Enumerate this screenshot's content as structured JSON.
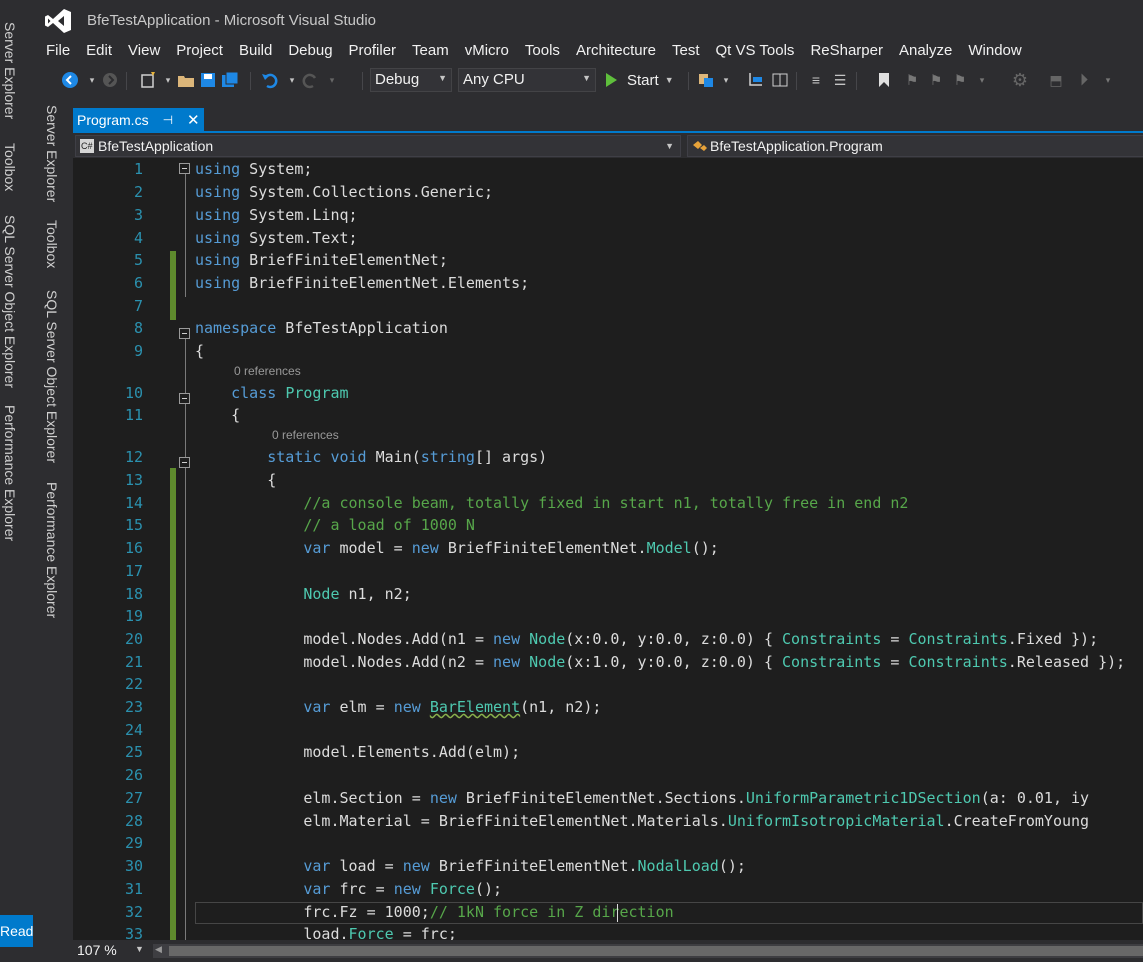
{
  "window": {
    "title": "BfeTestApplication - Microsoft Visual Studio"
  },
  "menu": [
    "File",
    "Edit",
    "View",
    "Project",
    "Build",
    "Debug",
    "Profiler",
    "Team",
    "vMicro",
    "Tools",
    "Architecture",
    "Test",
    "Qt VS Tools",
    "ReSharper",
    "Analyze",
    "Window"
  ],
  "toolbar": {
    "config": "Debug",
    "platform": "Any CPU",
    "start_label": "Start"
  },
  "side_tabs": [
    "Server Explorer",
    "Toolbox",
    "SQL Server Object Explorer",
    "Performance Explorer"
  ],
  "side_tabs_inner": [
    "Server Explorer",
    "Toolbox",
    "SQL Server Object Explorer",
    "Performance Explorer"
  ],
  "document_tab": {
    "name": "Program.cs"
  },
  "navbar": {
    "project": "BfeTestApplication",
    "type": "BfeTestApplication.Program",
    "cs_badge": "C#"
  },
  "codelens": {
    "class_refs": "0 references",
    "main_refs": "0 references"
  },
  "code": {
    "lines": [
      {
        "n": "1",
        "text": "using System;"
      },
      {
        "n": "2",
        "text": "using System.Collections.Generic;"
      },
      {
        "n": "3",
        "text": "using System.Linq;"
      },
      {
        "n": "4",
        "text": "using System.Text;"
      },
      {
        "n": "5",
        "text": "using BriefFiniteElementNet;"
      },
      {
        "n": "6",
        "text": "using BriefFiniteElementNet.Elements;"
      },
      {
        "n": "7",
        "text": ""
      },
      {
        "n": "8",
        "text": "namespace BfeTestApplication"
      },
      {
        "n": "9",
        "text": "{"
      },
      {
        "n": "10",
        "text": "    class Program"
      },
      {
        "n": "11",
        "text": "    {"
      },
      {
        "n": "12",
        "text": "        static void Main(string[] args)"
      },
      {
        "n": "13",
        "text": "        {"
      },
      {
        "n": "14",
        "text": "            //a console beam, totally fixed in start n1, totally free in end n2"
      },
      {
        "n": "15",
        "text": "            // a load of 1000 N"
      },
      {
        "n": "16",
        "text": "            var model = new BriefFiniteElementNet.Model();"
      },
      {
        "n": "17",
        "text": ""
      },
      {
        "n": "18",
        "text": "            Node n1, n2;"
      },
      {
        "n": "19",
        "text": ""
      },
      {
        "n": "20",
        "text": "            model.Nodes.Add(n1 = new Node(x:0.0, y:0.0, z:0.0) { Constraints = Constraints.Fixed });"
      },
      {
        "n": "21",
        "text": "            model.Nodes.Add(n2 = new Node(x:1.0, y:0.0, z:0.0) { Constraints = Constraints.Released });"
      },
      {
        "n": "22",
        "text": ""
      },
      {
        "n": "23",
        "text": "            var elm = new BarElement(n1, n2);"
      },
      {
        "n": "24",
        "text": ""
      },
      {
        "n": "25",
        "text": "            model.Elements.Add(elm);"
      },
      {
        "n": "26",
        "text": ""
      },
      {
        "n": "27",
        "text": "            elm.Section = new BriefFiniteElementNet.Sections.UniformParametric1DSection(a: 0.01, iy"
      },
      {
        "n": "28",
        "text": "            elm.Material = BriefFiniteElementNet.Materials.UniformIsotropicMaterial.CreateFromYoung"
      },
      {
        "n": "29",
        "text": ""
      },
      {
        "n": "30",
        "text": "            var load = new BriefFiniteElementNet.NodalLoad();"
      },
      {
        "n": "31",
        "text": "            var frc = new Force();"
      },
      {
        "n": "32",
        "text": "            frc.Fz = 1000;// 1kN force in Z direction"
      },
      {
        "n": "33",
        "text": "            load.Force = frc;"
      }
    ]
  },
  "status": {
    "zoom": "107 %",
    "state": "Ready"
  },
  "colors": {
    "accent": "#007acc",
    "editor_bg": "#1e1e1e",
    "keyword": "#569cd6",
    "type": "#4ec9b0",
    "comment": "#57a64a",
    "line_number": "#2b91af"
  }
}
